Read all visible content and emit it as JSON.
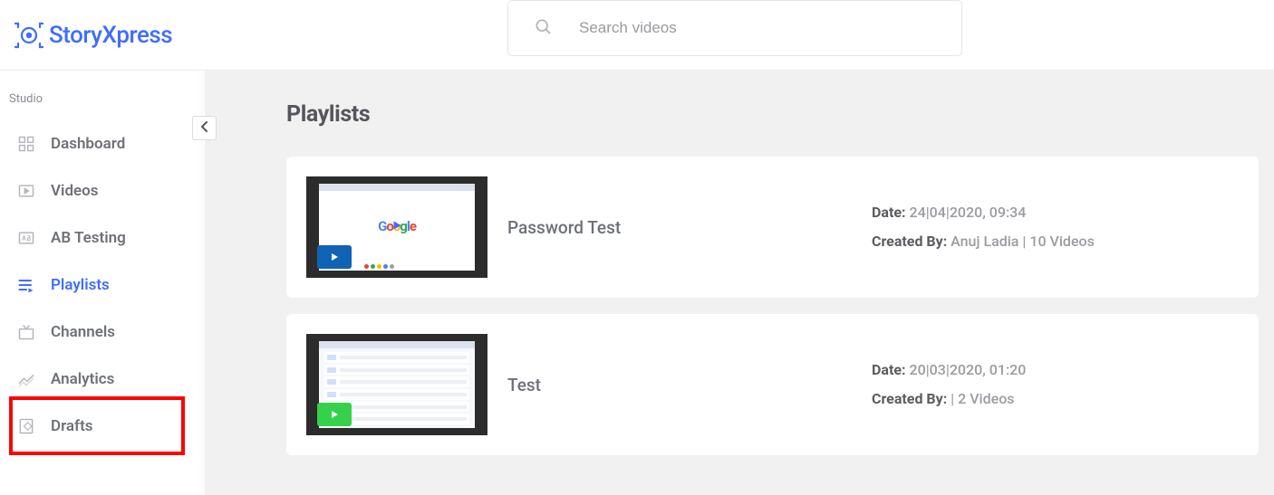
{
  "brand": "StoryXpress",
  "search": {
    "placeholder": "Search videos"
  },
  "sidebar": {
    "section_label": "Studio",
    "items": [
      {
        "label": "Dashboard"
      },
      {
        "label": "Videos"
      },
      {
        "label": "AB Testing"
      },
      {
        "label": "Playlists"
      },
      {
        "label": "Channels"
      },
      {
        "label": "Analytics"
      },
      {
        "label": "Drafts"
      }
    ],
    "active_index": 3,
    "highlighted_index": 4
  },
  "page": {
    "title": "Playlists"
  },
  "playlists": [
    {
      "title": "Password Test",
      "date_label": "Date:",
      "date": "24|04|2020, 09:34",
      "created_label": "Created By:",
      "created_by": "Anuj Ladia | 10 Videos",
      "badge_color": "blue"
    },
    {
      "title": "Test",
      "date_label": "Date:",
      "date": "20|03|2020, 01:20",
      "created_label": "Created By:",
      "created_by": " | 2 Videos",
      "badge_color": "green"
    }
  ]
}
